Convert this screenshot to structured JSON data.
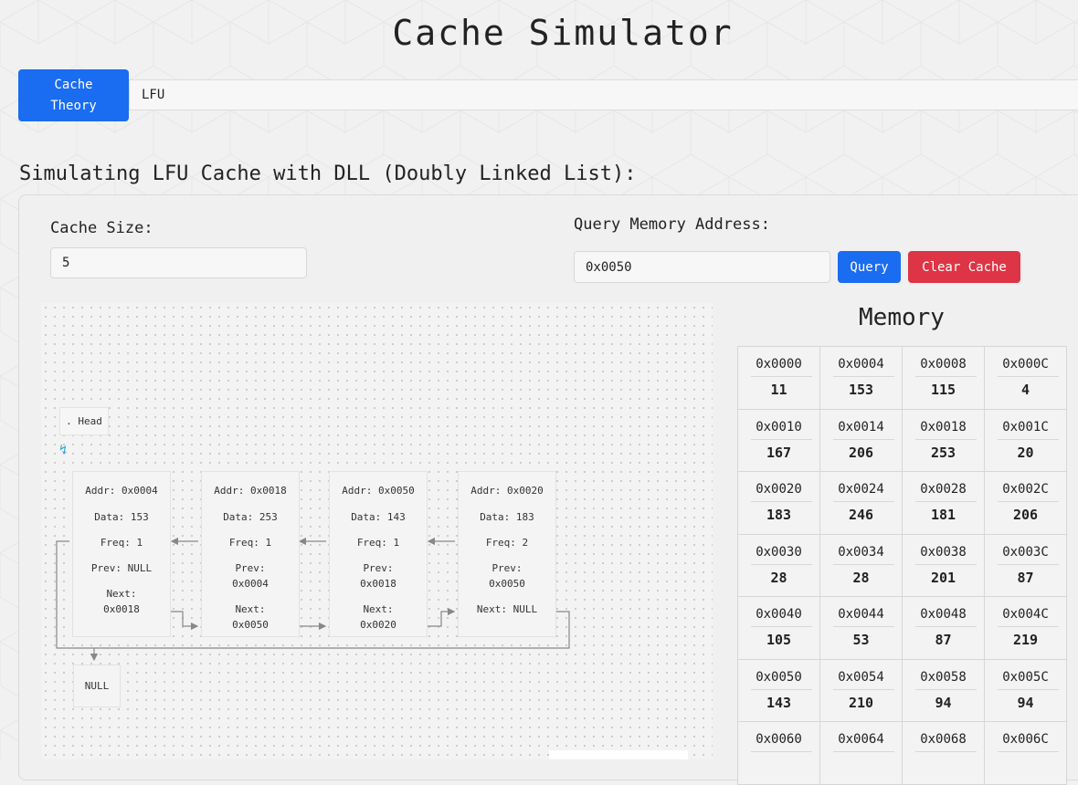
{
  "header": {
    "title": "Cache Simulator"
  },
  "toolbar": {
    "theory_button": "Cache\nTheory",
    "policy_value": "LFU"
  },
  "simulation": {
    "heading": "Simulating LFU Cache with DLL (Doubly Linked List):"
  },
  "controls": {
    "cache_size_label": "Cache Size:",
    "cache_size_value": "5",
    "query_label": "Query Memory Address:",
    "query_value": "0x0050",
    "query_button": "Query",
    "clear_button": "Clear Cache"
  },
  "dll": {
    "head_label": ". Head",
    "null_label": "NULL",
    "nodes": [
      {
        "addr": "Addr: 0x0004",
        "data": "Data: 153",
        "freq": "Freq: 1",
        "prev": "Prev: NULL",
        "next": "Next:\n0x0018"
      },
      {
        "addr": "Addr: 0x0018",
        "data": "Data: 253",
        "freq": "Freq: 1",
        "prev": "Prev:\n0x0004",
        "next": "Next:\n0x0050"
      },
      {
        "addr": "Addr: 0x0050",
        "data": "Data: 143",
        "freq": "Freq: 1",
        "prev": "Prev:\n0x0018",
        "next": "Next:\n0x0020"
      },
      {
        "addr": "Addr: 0x0020",
        "data": "Data: 183",
        "freq": "Freq: 2",
        "prev": "Prev:\n0x0050",
        "next": "Next: NULL"
      }
    ]
  },
  "memory": {
    "title": "Memory",
    "cells": [
      {
        "addr": "0x0000",
        "value": "11"
      },
      {
        "addr": "0x0004",
        "value": "153"
      },
      {
        "addr": "0x0008",
        "value": "115"
      },
      {
        "addr": "0x000C",
        "value": "4"
      },
      {
        "addr": "0x0010",
        "value": "167"
      },
      {
        "addr": "0x0014",
        "value": "206"
      },
      {
        "addr": "0x0018",
        "value": "253"
      },
      {
        "addr": "0x001C",
        "value": "20"
      },
      {
        "addr": "0x0020",
        "value": "183"
      },
      {
        "addr": "0x0024",
        "value": "246"
      },
      {
        "addr": "0x0028",
        "value": "181"
      },
      {
        "addr": "0x002C",
        "value": "206"
      },
      {
        "addr": "0x0030",
        "value": "28"
      },
      {
        "addr": "0x0034",
        "value": "28"
      },
      {
        "addr": "0x0038",
        "value": "201"
      },
      {
        "addr": "0x003C",
        "value": "87"
      },
      {
        "addr": "0x0040",
        "value": "105"
      },
      {
        "addr": "0x0044",
        "value": "53"
      },
      {
        "addr": "0x0048",
        "value": "87"
      },
      {
        "addr": "0x004C",
        "value": "219"
      },
      {
        "addr": "0x0050",
        "value": "143"
      },
      {
        "addr": "0x0054",
        "value": "210"
      },
      {
        "addr": "0x0058",
        "value": "94"
      },
      {
        "addr": "0x005C",
        "value": "94"
      },
      {
        "addr": "0x0060",
        "value": ""
      },
      {
        "addr": "0x0064",
        "value": ""
      },
      {
        "addr": "0x0068",
        "value": ""
      },
      {
        "addr": "0x006C",
        "value": ""
      }
    ]
  },
  "colors": {
    "primary": "#1a6cf0",
    "danger": "#dd3545",
    "pointer": "#2aa6c8"
  },
  "icons": {
    "head_pointer": "pointer-arrow-icon"
  }
}
